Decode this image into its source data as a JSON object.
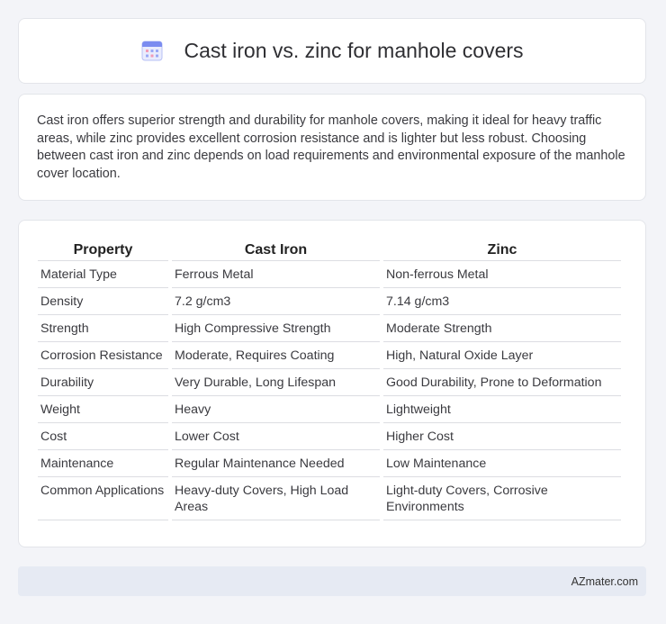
{
  "header": {
    "icon": "calendar-icon",
    "title": "Cast iron vs. zinc for manhole covers"
  },
  "intro": {
    "text": "Cast iron offers superior strength and durability for manhole covers, making it ideal for heavy traffic areas, while zinc provides excellent corrosion resistance and is lighter but less robust. Choosing between cast iron and zinc depends on load requirements and environmental exposure of the manhole cover location."
  },
  "table": {
    "headers": [
      "Property",
      "Cast Iron",
      "Zinc"
    ],
    "rows": [
      [
        "Material Type",
        "Ferrous Metal",
        "Non-ferrous Metal"
      ],
      [
        "Density",
        "7.2 g/cm3",
        "7.14 g/cm3"
      ],
      [
        "Strength",
        "High Compressive Strength",
        "Moderate Strength"
      ],
      [
        "Corrosion Resistance",
        "Moderate, Requires Coating",
        "High, Natural Oxide Layer"
      ],
      [
        "Durability",
        "Very Durable, Long Lifespan",
        "Good Durability, Prone to Deformation"
      ],
      [
        "Weight",
        "Heavy",
        "Lightweight"
      ],
      [
        "Cost",
        "Lower Cost",
        "Higher Cost"
      ],
      [
        "Maintenance",
        "Regular Maintenance Needed",
        "Low Maintenance"
      ],
      [
        "Common Applications",
        "Heavy-duty Covers, High Load Areas",
        "Light-duty Covers, Corrosive Environments"
      ]
    ]
  },
  "footer": {
    "brand": "AZmater.com"
  },
  "colors": {
    "background": "#f3f4f8",
    "card": "#ffffff",
    "footer": "#e6eaf3",
    "icon_accent": "#7b8cf0"
  }
}
